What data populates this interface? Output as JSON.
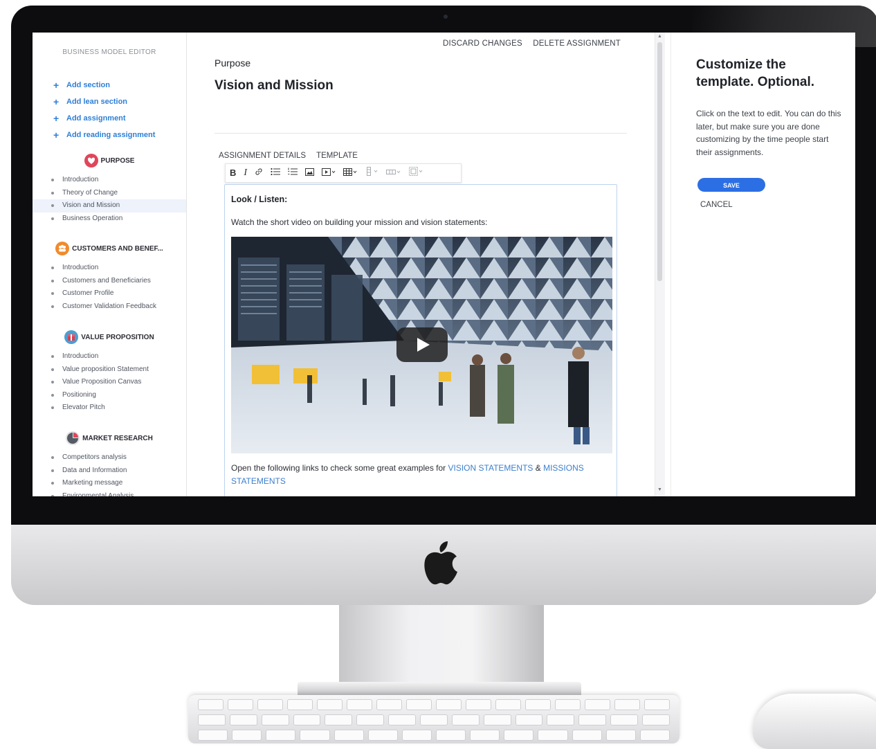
{
  "sidebar": {
    "title": "BUSINESS MODEL EDITOR",
    "add_items": [
      {
        "label": "Add section"
      },
      {
        "label": "Add lean section"
      },
      {
        "label": "Add assignment"
      },
      {
        "label": "Add reading assignment"
      }
    ],
    "sections": [
      {
        "title": "PURPOSE",
        "icon": "purpose-icon",
        "items": [
          "Introduction",
          "Theory of Change",
          "Vision and Mission",
          "Business Operation"
        ],
        "active_index": 2
      },
      {
        "title": "CUSTOMERS AND BENEF...",
        "icon": "customers-icon",
        "items": [
          "Introduction",
          "Customers and Beneficiaries",
          "Customer Profile",
          "Customer Validation Feedback"
        ]
      },
      {
        "title": "VALUE PROPOSITION",
        "icon": "value-proposition-icon",
        "items": [
          "Introduction",
          "Value proposition Statement",
          "Value Proposition Canvas",
          "Positioning",
          "Elevator Pitch"
        ]
      },
      {
        "title": "MARKET RESEARCH",
        "icon": "market-research-icon",
        "items": [
          "Competitors analysis",
          "Data and Information",
          "Marketing message",
          "Environmental Analysis"
        ]
      }
    ]
  },
  "header": {
    "discard_label": "DISCARD CHANGES",
    "delete_label": "DELETE ASSIGNMENT",
    "breadcrumb": "Purpose",
    "title": "Vision and Mission"
  },
  "tabs": [
    "ASSIGNMENT DETAILS",
    "TEMPLATE"
  ],
  "editor": {
    "toolbar": [
      "bold-icon",
      "italic-icon",
      "link-icon",
      "bulleted-list-icon",
      "numbered-list-icon",
      "image-icon",
      "media-embed-icon",
      "table-icon",
      "column-icon",
      "row-icon",
      "merge-cells-icon"
    ],
    "heading": "Look / Listen:",
    "intro_text": "Watch the short video on building your mission and vision statements:",
    "links_text_before": "Open the following links to check some great examples for ",
    "link_vision": "VISION STATEMENTS",
    "links_amp": " & ",
    "link_missions": "MISSIONS STATEMENTS"
  },
  "right_panel": {
    "title": "Customize the template. Optional.",
    "description": "Click on the text to edit. You can do this later, but make sure you are done customizing by the time people start their assignments.",
    "save_label": "SAVE",
    "cancel_label": "CANCEL"
  },
  "colors": {
    "accent_blue": "#2e7fd6",
    "save_button": "#2c6fe4",
    "link": "#3c7fce",
    "active_item_bg": "#edf2fb",
    "purpose_icon": "#e0465a",
    "customers_icon": "#f08b2d",
    "value_icon": "#d8404f",
    "market_icon": "#555a63"
  }
}
